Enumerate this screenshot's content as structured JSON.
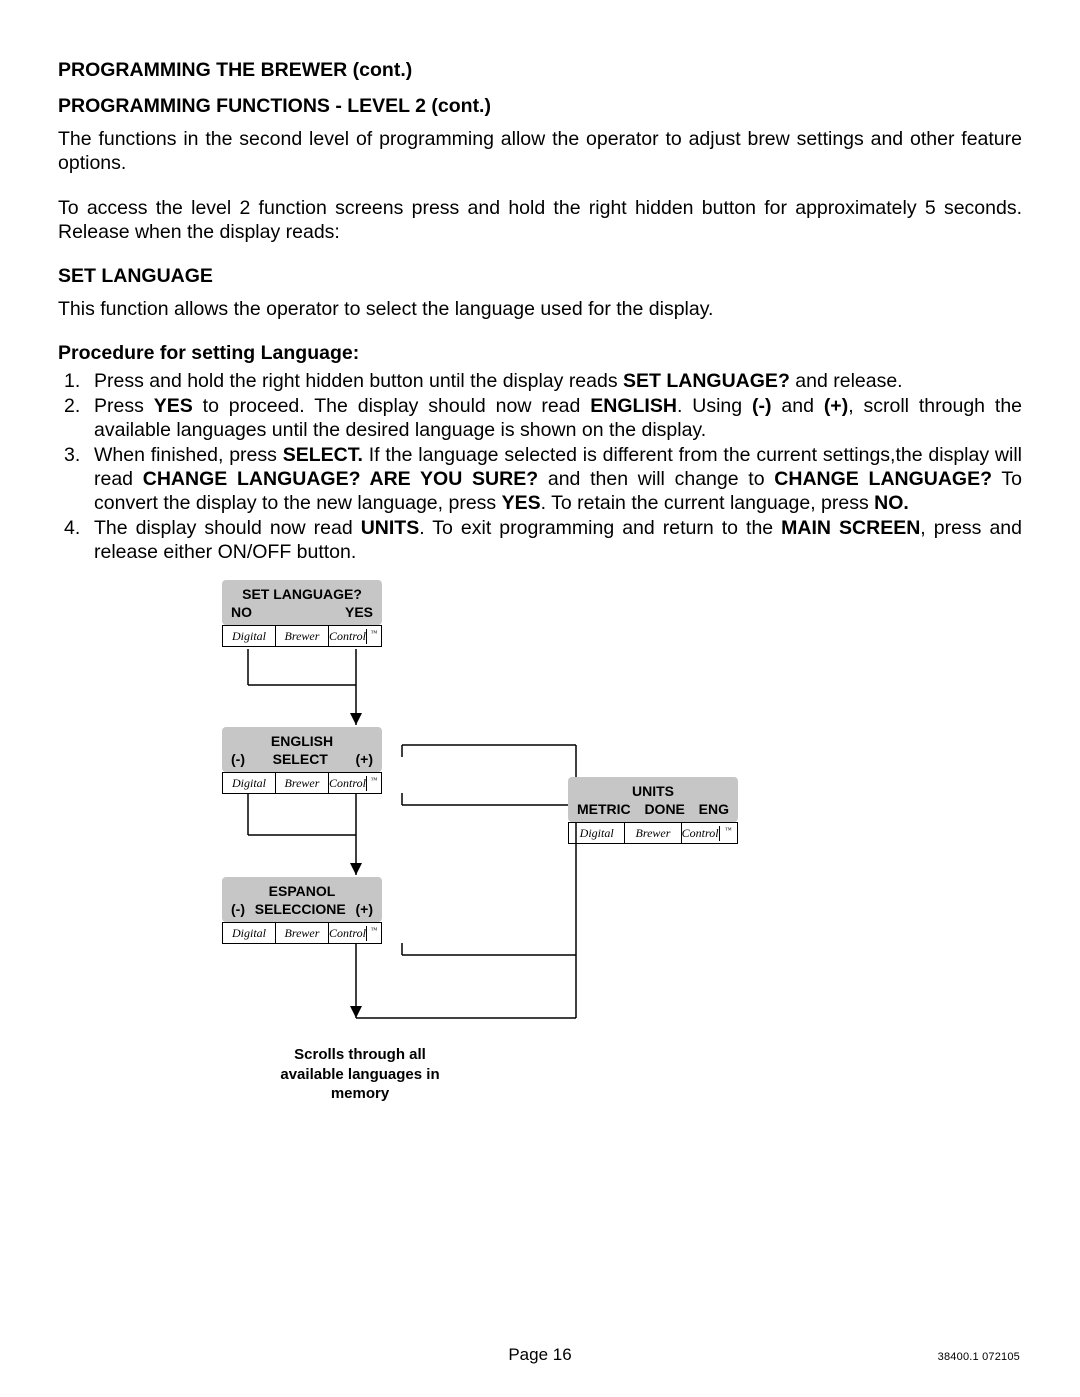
{
  "heading1": "PROGRAMMING THE BREWER (cont.)",
  "heading2": "PROGRAMMING FUNCTIONS - LEVEL  2 (cont.)",
  "intro1": "The functions in the second level of programming allow the operator to adjust brew settings and other feature options.",
  "intro2": "To access the level 2 function screens press and hold the right hidden button for approximately 5 seconds. Release when the display reads:",
  "heading3": "SET LANGUAGE",
  "intro3": "This function allows the operator to select the language used for the display.",
  "procHeading": "Procedure for setting Language:",
  "steps": {
    "s1a": "Press and hold the right hidden button until the display reads ",
    "s1b": "SET LANGUAGE?",
    "s1c": "  and release.",
    "s2a": "Press ",
    "s2b": "YES",
    "s2c": " to proceed. The display should now read ",
    "s2d": "ENGLISH",
    "s2e": ". Using ",
    "s2f": "(-)",
    "s2g": " and ",
    "s2h": "(+)",
    "s2i": ",  scroll through the available languages until the desired language is shown on the display.",
    "s3a": "When finished, press ",
    "s3b": "SELECT.",
    "s3c": " If the language selected is different from the current settings,the display will read ",
    "s3d": "CHANGE LANGUAGE? ARE YOU SURE?",
    "s3e": " and then will change to ",
    "s3f": "CHANGE LANGUAGE?",
    "s3g": " To convert the display to the new language, press ",
    "s3h": "YES",
    "s3i": ". To retain the current language, press ",
    "s3j": "NO.",
    "s4a": "The display should now read ",
    "s4b": "UNITS",
    "s4c": ". To exit programming and return to the ",
    "s4d": "MAIN SCREEN",
    "s4e": ", press and release either ON/OFF button."
  },
  "diagram": {
    "screen1": {
      "line1": "SET LANGUAGE?",
      "left": "NO",
      "right": "YES"
    },
    "screen2": {
      "line1": "ENGLISH",
      "left": "(-)",
      "mid": "SELECT",
      "right": "(+)"
    },
    "screen3": {
      "line1": "ESPANOL",
      "left": "(-)",
      "mid": "SELECCIONE",
      "right": "(+)"
    },
    "screen4": {
      "line1": "UNITS",
      "left": "METRIC",
      "mid": "DONE",
      "right": "ENG"
    },
    "note": "Scrolls through all available languages in memory",
    "brand": {
      "a": "Digital",
      "b": "Brewer",
      "c": "Control",
      "tm": "™"
    }
  },
  "footer": "Page 16",
  "docnum": "38400.1 072105"
}
